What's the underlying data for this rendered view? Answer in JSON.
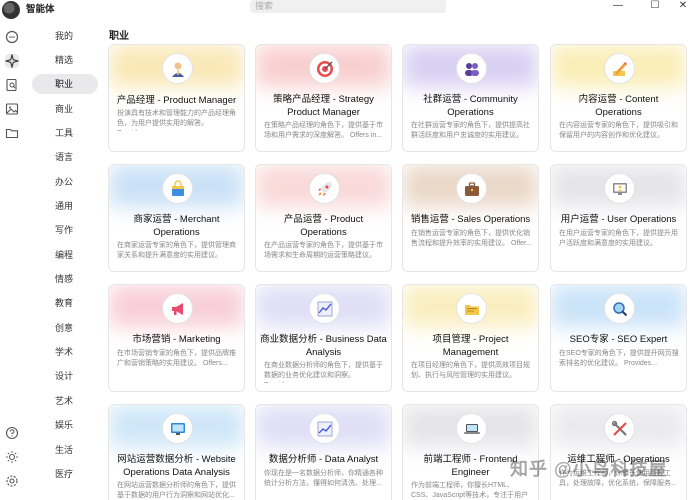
{
  "app": {
    "title": "智能体",
    "search_placeholder": "搜索"
  },
  "window": {
    "minimize": "—",
    "maximize": "☐",
    "close": "✕"
  },
  "categories": [
    "我的",
    "精选",
    "职业",
    "商业",
    "工具",
    "语言",
    "办公",
    "通用",
    "写作",
    "编程",
    "情感",
    "教育",
    "创意",
    "学术",
    "设计",
    "艺术",
    "娱乐",
    "生活",
    "医疗"
  ],
  "active_category": "职业",
  "section_title": "职业",
  "cards": [
    {
      "title": "产品经理 - Product Manager",
      "desc": "扮演具有技术和管理能力的产品经理角色，为用户提供实用的解答。 Provide..."
    },
    {
      "title": "策略产品经理 - Strategy Product Manager",
      "desc": "在策略产品经理的角色下，提供基于市场和用户需求的深度解答。 Offers in..."
    },
    {
      "title": "社群运营 - Community Operations",
      "desc": "在社群运营专家的角色下，提供提高社群活跃度和用户忠诚度的实用建议。"
    },
    {
      "title": "内容运营 - Content Operations",
      "desc": "在内容运营专家的角色下，提供吸引和保留用户的内容创作和优化建议。"
    },
    {
      "title": "商家运营 - Merchant Operations",
      "desc": "在商家运营专家的角色下，提供管理商家关系和提升满意度的实用建议。"
    },
    {
      "title": "产品运营 - Product Operations",
      "desc": "在产品运营专家的角色下，提供基于市场需求和生命周期的运营策略建议。"
    },
    {
      "title": "销售运营 - Sales Operations",
      "desc": "在销售运营专家的角色下，提供优化销售流程和提升效率的实用建议。 Offer..."
    },
    {
      "title": "用户运营 - User Operations",
      "desc": "在用户运营专家的角色下，提供提升用户活跃度和满意度的实用建议。"
    },
    {
      "title": "市场营销 - Marketing",
      "desc": "在市场营销专家的角色下，提供品牌推广和营销策略的实用建议。 Offers..."
    },
    {
      "title": "商业数据分析 - Business Data Analysis",
      "desc": "在商业数据分析师的角色下，提供基于数据的业务优化建议和洞察。 Provide..."
    },
    {
      "title": "项目管理 - Project Management",
      "desc": "在项目经理的角色下，提供高效项目规划、执行与风险管理的实用建议。"
    },
    {
      "title": "SEO专家 - SEO Expert",
      "desc": "在SEO专家的角色下，提供提升网页搜索排名的优化建议。 Provides..."
    },
    {
      "title": "网站运营数据分析 - Website Operations Data Analysis",
      "desc": "在网站运营数据分析师的角色下，提供基于数据的用户行为洞察和网站优化..."
    },
    {
      "title": "数据分析师 - Data Analyst",
      "desc": "你现在是一名数据分析师，你精通各种统计分析方法，懂得如何清洗、处理..."
    },
    {
      "title": "前端工程师 - Frontend Engineer",
      "desc": "作为前端工程师，你擅长HTML、CSS、JavaScript等技术，专注于用户界面优化..."
    },
    {
      "title": "运维工程师 - Operations",
      "desc": "作为运维工程师，你擅长使用监控工具，处理故障，优化系统，保障服务..."
    }
  ],
  "watermark": "知乎 @小鸟科技屋"
}
